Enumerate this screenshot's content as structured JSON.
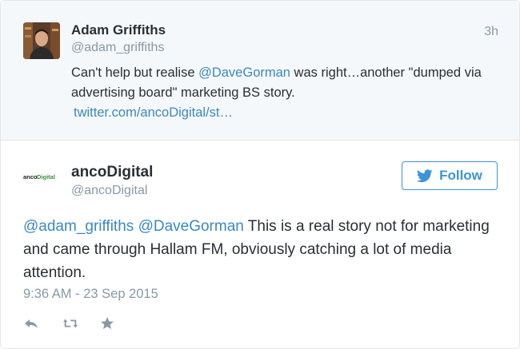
{
  "parent_tweet": {
    "author_name": "Adam Griffiths",
    "author_handle": "@adam_griffiths",
    "timestamp": "3h",
    "text_before": "Can't help but realise ",
    "mention": "@DaveGorman",
    "text_after": " was right…another \"dumped via advertising board\" marketing BS story.",
    "link": "twitter.com/ancoDigital/st…"
  },
  "main_tweet": {
    "author_name": "ancoDigital",
    "author_handle": "@ancoDigital",
    "logo_text": "ancoDigital",
    "follow_label": "Follow",
    "mention1": "@adam_griffiths",
    "mention2": "@DaveGorman",
    "text": " This is a real story not for marketing and came through Hallam FM, obviously catching a lot of media attention.",
    "date": "9:36 AM - 23 Sep 2015"
  },
  "icons": {
    "reply": "reply-icon",
    "retweet": "retweet-icon",
    "favorite": "star-icon",
    "follow": "twitter-bird-icon"
  },
  "colors": {
    "link": "#3b88c3",
    "follow_blue": "#3b94d9",
    "muted": "#8899a6",
    "parent_bg": "#f5f8fa"
  }
}
